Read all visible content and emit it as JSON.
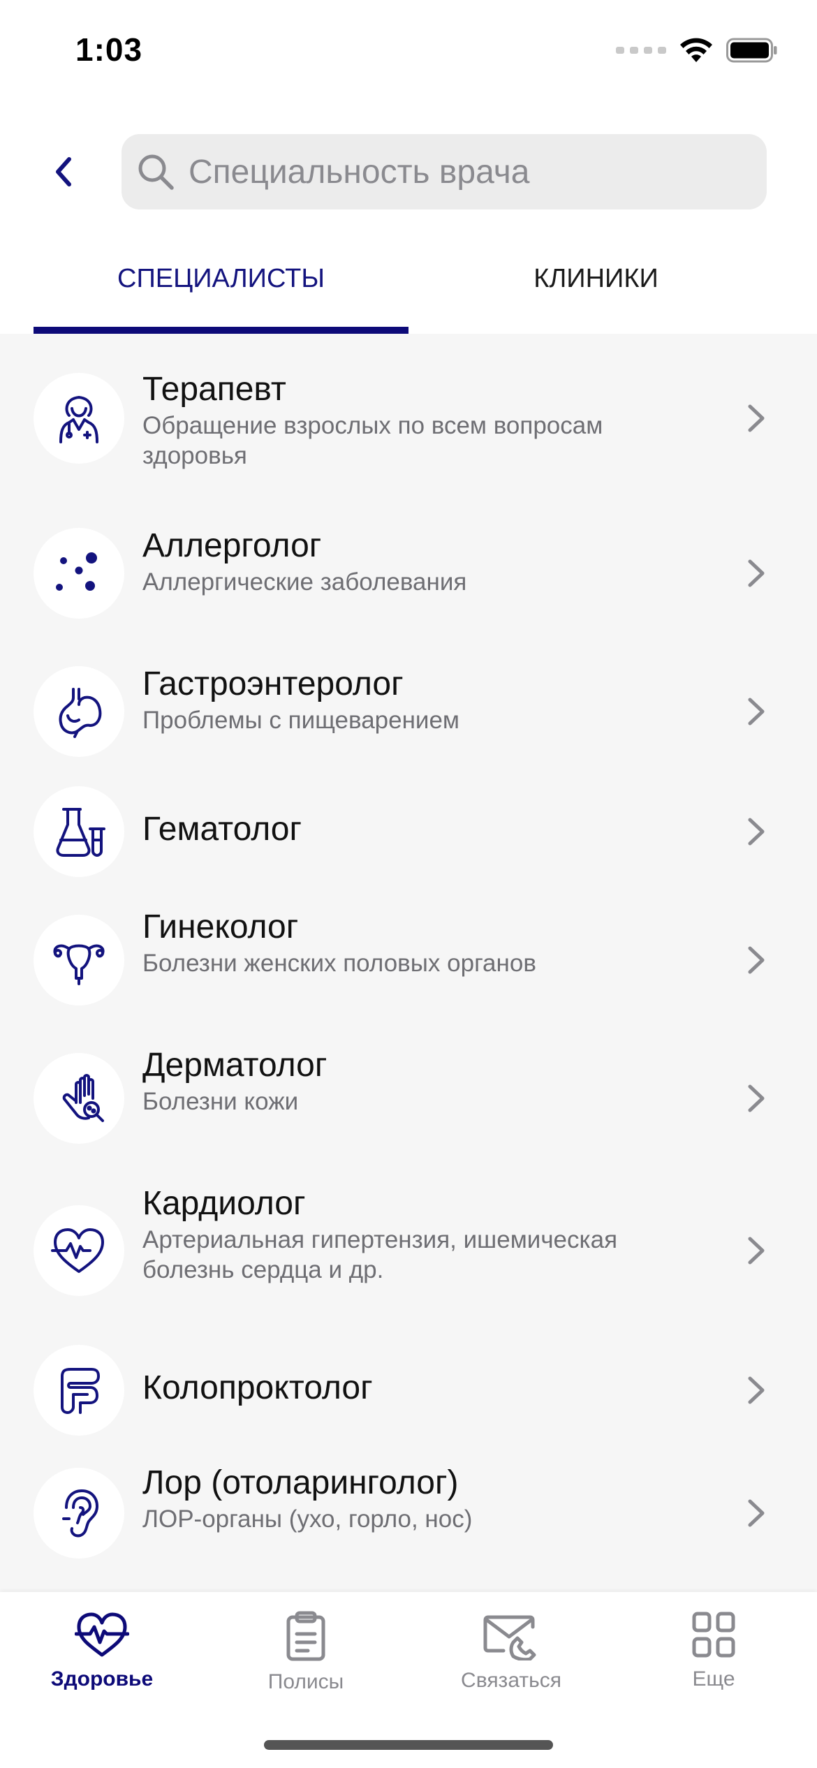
{
  "status_bar": {
    "time": "1:03"
  },
  "search": {
    "placeholder": "Специальность врача",
    "value": ""
  },
  "tabs": [
    {
      "label": "СПЕЦИАЛИСТЫ",
      "active": true
    },
    {
      "label": "КЛИНИКИ",
      "active": false
    }
  ],
  "specialists": [
    {
      "title": "Терапевт",
      "subtitle": "Обращение взрослых по всем вопросам здоровья",
      "icon": "doctor-icon"
    },
    {
      "title": "Аллерголог",
      "subtitle": "Аллергические заболевания",
      "icon": "allergy-dots-icon"
    },
    {
      "title": "Гастроэнтеролог",
      "subtitle": "Проблемы с пищеварением",
      "icon": "stomach-icon"
    },
    {
      "title": "Гематолог",
      "subtitle": "",
      "icon": "flask-icon"
    },
    {
      "title": "Гинеколог",
      "subtitle": "Болезни женских половых органов",
      "icon": "uterus-icon"
    },
    {
      "title": "Дерматолог",
      "subtitle": "Болезни кожи",
      "icon": "hand-magnifier-icon"
    },
    {
      "title": "Кардиолог",
      "subtitle": "Артериальная гипертензия, ишемическая болезнь сердца и др.",
      "icon": "heart-pulse-icon"
    },
    {
      "title": "Колопроктолог",
      "subtitle": "",
      "icon": "intestine-icon"
    },
    {
      "title": "Лор (отоларинголог)",
      "subtitle": "ЛОР-органы (ухо, горло, нос)",
      "icon": "ear-icon"
    }
  ],
  "tabbar": [
    {
      "label": "Здоровье",
      "active": true,
      "icon": "heart-pulse-icon"
    },
    {
      "label": "Полисы",
      "active": false,
      "icon": "clipboard-icon"
    },
    {
      "label": "Связаться",
      "active": false,
      "icon": "envelope-phone-icon"
    },
    {
      "label": "Еще",
      "active": false,
      "icon": "grid-icon"
    }
  ],
  "colors": {
    "accent": "#0d0a78",
    "inactive": "#8a8a8f",
    "background": "#f6f6f6"
  }
}
